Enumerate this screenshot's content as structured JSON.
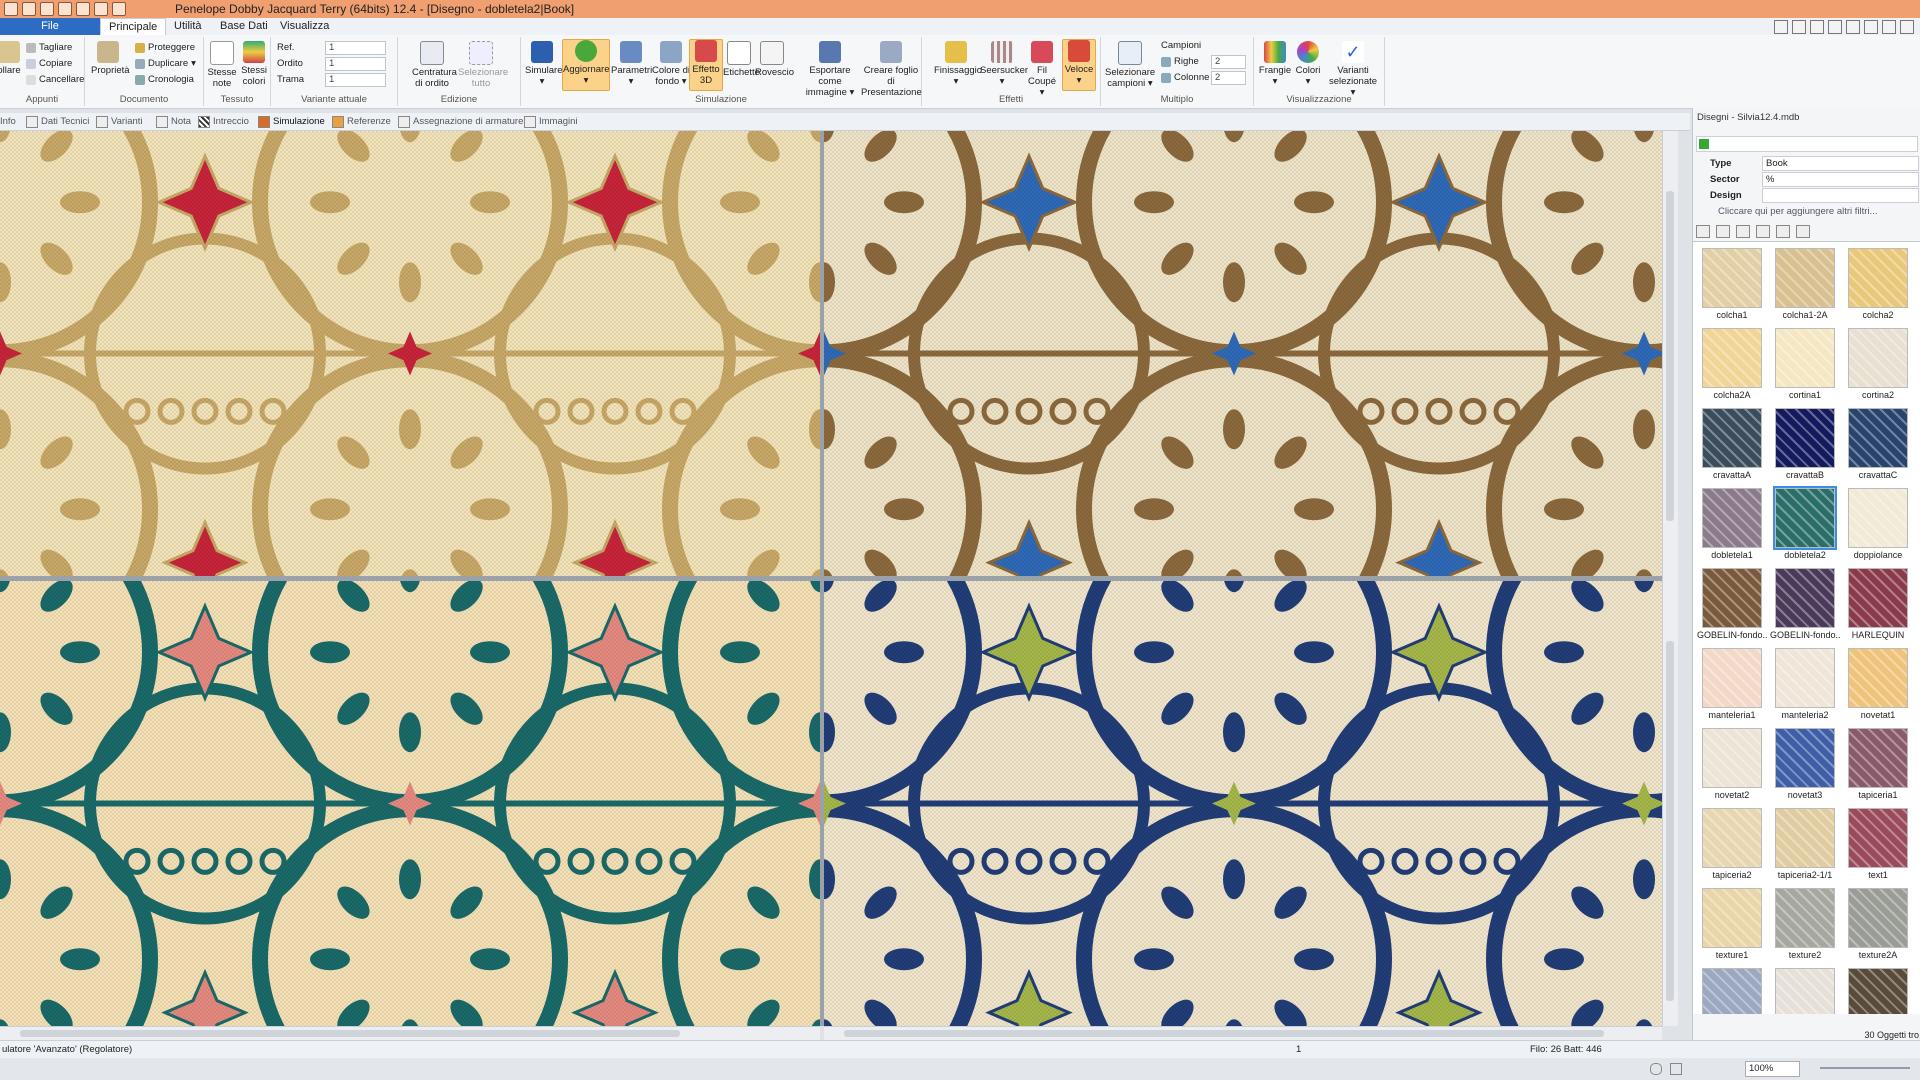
{
  "app_title": "Penelope Dobby Jacquard Terry (64bits) 12.4 - [Disegno - dobletela2|Book]",
  "menu": {
    "file": "File",
    "tabs": [
      "Principale",
      "Utilità",
      "Base Dati",
      "Visualizza"
    ]
  },
  "ribbon": {
    "appunti": {
      "label": "Appunti",
      "incollare": "ollare",
      "tagliare": "Tagliare",
      "copiare": "Copiare",
      "cancellare": "Cancellare"
    },
    "documento": {
      "label": "Documento",
      "proprieta": "Proprietà",
      "proteggere": "Proteggere",
      "duplicare": "Duplicare",
      "cronologia": "Cronologia"
    },
    "tessuto": {
      "label": "Tessuto",
      "stesse_note": "Stesse note",
      "stessi_colori": "Stessi colori"
    },
    "variante": {
      "label": "Variante attuale",
      "ref": "Ref.",
      "ordito": "Ordito",
      "trama": "Trama",
      "ref_val": "1",
      "ordito_val": "1",
      "trama_val": "1"
    },
    "edizione": {
      "label": "Edizione",
      "centratura": "Centratura di ordito",
      "selezionare": "Selezionare tutto"
    },
    "simulazione": {
      "label": "Simulazione",
      "simulare": "Simulare",
      "aggiornare": "Aggiornare",
      "parametri": "Parametri",
      "colore_fondo": "Colore di fondo",
      "effetto3d": "Effetto 3D",
      "etichette": "Etichette",
      "rovescio": "Rovescio",
      "esportare": "Esportare come immagine",
      "creare": "Creare foglio di Presentazione"
    },
    "effetti": {
      "label": "Effetti",
      "finissaggio": "Finissaggio",
      "seersucker": "Seersucker",
      "fil_coupe": "Fil Coupé",
      "veloce": "Veloce"
    },
    "multiplo": {
      "label": "Multiplo",
      "selezionare_campioni": "Selezionare campioni",
      "campioni": "Campioni",
      "righe": "Righe",
      "colonne": "Colonne",
      "righe_val": "2",
      "colonne_val": "2"
    },
    "visualizzazione": {
      "label": "Visualizzazione",
      "frangie": "Frangie",
      "colori": "Colori",
      "varianti": "Varianti selezionate"
    }
  },
  "doc_tabs": [
    "Info",
    "Dati Tecnici",
    "Varianti",
    "Nota",
    "Intreccio",
    "Simulazione",
    "Referenze",
    "Assegnazione di armature",
    "Immagini"
  ],
  "doc_tab_active": "Simulazione",
  "variants": [
    {
      "name": "variant-1",
      "bg": "#f2e3b8",
      "fg": "#c9a968",
      "accent": "#c8243a"
    },
    {
      "name": "variant-2",
      "bg": "#efe4c7",
      "fg": "#8c6a3e",
      "accent": "#2f6ab8"
    },
    {
      "name": "variant-3",
      "bg": "#f5e1b6",
      "fg": "#1a6a6a",
      "accent": "#e68a80"
    },
    {
      "name": "variant-4",
      "bg": "#f1e6cc",
      "fg": "#213e78",
      "accent": "#a6b84a"
    }
  ],
  "panel": {
    "title": "Disegni - Silvia12.4.mdb",
    "filters": [
      {
        "key": "Type",
        "value": "Book"
      },
      {
        "key": "Sector",
        "value": "%"
      },
      {
        "key": "Design",
        "value": ""
      }
    ],
    "add_filter": "Cliccare qui per aggiungere altri filtri...",
    "count": "30 Oggetti tro",
    "items": [
      {
        "name": "colcha1",
        "color": "#e3cfa4"
      },
      {
        "name": "colcha1-2A",
        "color": "#d8c090"
      },
      {
        "name": "colcha2",
        "color": "#eac87a"
      },
      {
        "name": "colcha2A",
        "color": "#f0d596"
      },
      {
        "name": "cortina1",
        "color": "#f4e7c2"
      },
      {
        "name": "cortina2",
        "color": "#e8e0d0"
      },
      {
        "name": "cravattaA",
        "color": "#3b4d5c"
      },
      {
        "name": "cravattaB",
        "color": "#141a5e"
      },
      {
        "name": "cravattaC",
        "color": "#27436e"
      },
      {
        "name": "dobletela1",
        "color": "#8a7a8a"
      },
      {
        "name": "dobletela2",
        "color": "#2a6e6a"
      },
      {
        "name": "doppiolance",
        "color": "#f1ead6"
      },
      {
        "name": "GOBELIN-fondo...",
        "color": "#7a5a3a"
      },
      {
        "name": "GOBELIN-fondo...",
        "color": "#4a3a5a"
      },
      {
        "name": "HARLEQUIN",
        "color": "#8a3a4a"
      },
      {
        "name": "manteleria1",
        "color": "#f3d8c8"
      },
      {
        "name": "manteleria2",
        "color": "#efe6d9"
      },
      {
        "name": "novetat1",
        "color": "#efc47a"
      },
      {
        "name": "novetat2",
        "color": "#ece4d4"
      },
      {
        "name": "novetat3",
        "color": "#3e5ea8"
      },
      {
        "name": "tapiceria1",
        "color": "#8a5a6a"
      },
      {
        "name": "tapiceria2",
        "color": "#e8d6b0"
      },
      {
        "name": "tapiceria2-1/1",
        "color": "#e0cca0"
      },
      {
        "name": "text1",
        "color": "#9a4a5a"
      },
      {
        "name": "texture1",
        "color": "#e9d5a8"
      },
      {
        "name": "texture2",
        "color": "#a6a8a0"
      },
      {
        "name": "texture2A",
        "color": "#9a9c96"
      },
      {
        "name": "",
        "color": "#9aa8c2"
      },
      {
        "name": "",
        "color": "#e6e0d8"
      },
      {
        "name": "",
        "color": "#5a4a3a"
      }
    ],
    "selected": "dobletela2"
  },
  "status": {
    "left": "ulatore 'Avanzato' (Regolatore)",
    "mid": "1",
    "right": "Filo: 26 Batt: 446"
  },
  "zoom": "100%"
}
